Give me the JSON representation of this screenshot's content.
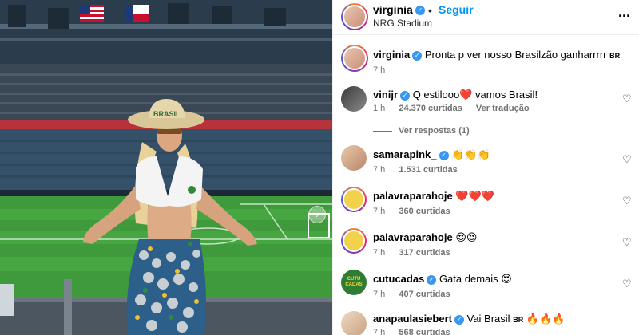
{
  "post": {
    "author": "virginia",
    "follow_label": "Seguir",
    "dot": "•",
    "location": "NRG Stadium",
    "more_icon": "ellipsis-icon"
  },
  "caption": {
    "user": "virginia",
    "text": "Pronta p ver nosso Brasilzão ganharrrrr",
    "flag": "BR",
    "time": "7 h"
  },
  "comments": [
    {
      "user": "vinijr",
      "text": "Q estilooo❤️ vamos Brasil!",
      "time": "1 h",
      "likes": "24.370 curtidas",
      "action": "Ver tradução",
      "replies": "Ver respostas (1)"
    },
    {
      "user": "samarapink_",
      "text": "👏👏👏",
      "time": "7 h",
      "likes": "1.531 curtidas"
    },
    {
      "user": "palavraparahoje",
      "text": "❤️❤️❤️",
      "time": "7 h",
      "likes": "360 curtidas"
    },
    {
      "user": "palavraparahoje",
      "text": "😍😍",
      "time": "7 h",
      "likes": "317 curtidas"
    },
    {
      "user": "cutucadas",
      "text": "Gata demais 😍",
      "time": "7 h",
      "likes": "407 curtidas",
      "avatar_text": "CUTU CADAS"
    },
    {
      "user": "anapaulasiebert",
      "text": "Vai Brasil",
      "flag": "BR",
      "emoji": "🔥🔥🔥",
      "time": "7 h",
      "likes": "568 curtidas"
    }
  ],
  "photo_hat_text": "BRASIL",
  "colors": {
    "link_blue": "#0095f6",
    "verified_blue": "#3897f0",
    "muted": "#737373",
    "pitch_green": "#3f9a3c"
  }
}
